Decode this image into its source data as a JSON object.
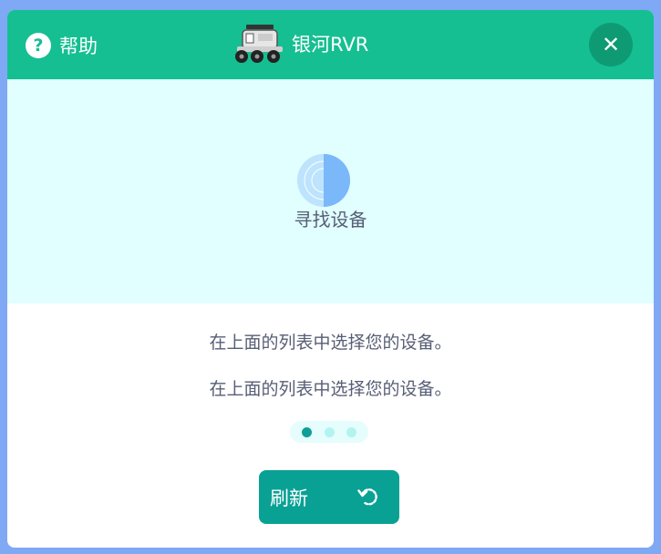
{
  "header": {
    "help_label": "帮助",
    "title": "银河RVR",
    "help_icon": "question-circle-icon",
    "device_icon": "rover-icon",
    "close_icon": "close-icon"
  },
  "scan": {
    "label": "寻找设备",
    "icon": "radar-icon"
  },
  "instructions": [
    "在上面的列表中选择您的设备。",
    "在上面的列表中选择您的设备。"
  ],
  "pagination": {
    "total": 3,
    "active_index": 0
  },
  "refresh": {
    "label": "刷新",
    "icon": "refresh-icon"
  },
  "colors": {
    "header_bg": "#15bf92",
    "scan_bg": "#e0fffe",
    "button_bg": "#0aa195",
    "text": "#575e75",
    "page_bg": "#7fa8f5"
  }
}
